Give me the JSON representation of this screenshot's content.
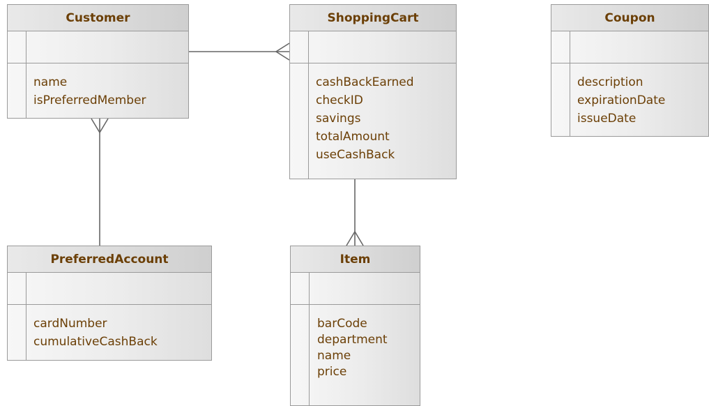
{
  "entities": [
    {
      "name": "Customer",
      "attributes": [
        "name",
        "isPreferredMember"
      ]
    },
    {
      "name": "ShoppingCart",
      "attributes": [
        "cashBackEarned",
        "checkID",
        "savings",
        "totalAmount",
        "useCashBack"
      ]
    },
    {
      "name": "Coupon",
      "attributes": [
        "description",
        "expirationDate",
        "issueDate"
      ]
    },
    {
      "name": "PreferredAccount",
      "attributes": [
        "cardNumber",
        "cumulativeCashBack"
      ]
    },
    {
      "name": "Item",
      "attributes": [
        "barCode",
        "department",
        "name",
        "price"
      ]
    }
  ],
  "relationships": [
    {
      "from": "Customer",
      "to": "ShoppingCart",
      "from_cardinality": "one",
      "to_cardinality": "many"
    },
    {
      "from": "PreferredAccount",
      "to": "Customer",
      "from_cardinality": "one",
      "to_cardinality": "many"
    },
    {
      "from": "ShoppingCart",
      "to": "Item",
      "from_cardinality": "one",
      "to_cardinality": "many"
    }
  ]
}
